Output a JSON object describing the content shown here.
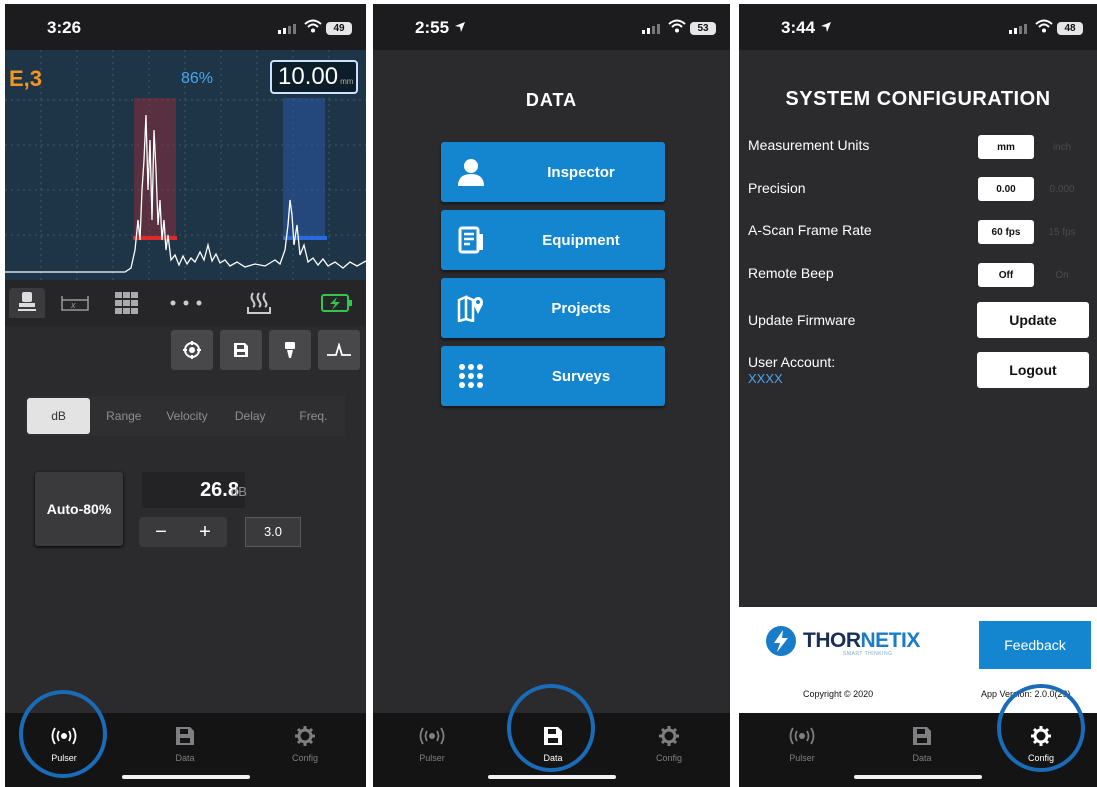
{
  "panel1": {
    "status": {
      "time": "3:26",
      "battery": "49"
    },
    "ascan": {
      "gate_mode": "E,3",
      "gain_percent": "86%",
      "thickness": "10.00",
      "thickness_unit": "mm"
    },
    "tools": [
      "transducer-icon",
      "caliper-icon",
      "grid-icon",
      "more-dots-icon",
      "couplant-icon",
      "battery-charging-icon"
    ],
    "actions": [
      "target-icon",
      "save-icon",
      "probe-icon",
      "waveform-icon"
    ],
    "params": {
      "tabs": [
        "dB",
        "Range",
        "Velocity",
        "Delay",
        "Freq."
      ],
      "selected": "dB"
    },
    "auto_button": "Auto-80%",
    "db_value": "26.8",
    "db_unit": "dB",
    "minus": "−",
    "plus": "+",
    "step": "3.0"
  },
  "panel2": {
    "status": {
      "time": "2:55",
      "battery": "53"
    },
    "title": "DATA",
    "buttons": [
      {
        "label": "Inspector",
        "icon": "person-icon"
      },
      {
        "label": "Equipment",
        "icon": "equipment-list-icon"
      },
      {
        "label": "Projects",
        "icon": "map-pin-icon"
      },
      {
        "label": "Surveys",
        "icon": "dots-grid-icon"
      }
    ]
  },
  "panel3": {
    "status": {
      "time": "3:44",
      "battery": "48"
    },
    "title": "SYSTEM CONFIGURATION",
    "rows": {
      "units": {
        "label": "Measurement Units",
        "options": [
          "mm",
          "inch"
        ],
        "selected": "mm"
      },
      "precision": {
        "label": "Precision",
        "options": [
          "0.00",
          "0.000"
        ],
        "selected": "0.00"
      },
      "framerate": {
        "label": "A-Scan Frame Rate",
        "options": [
          "60 fps",
          "15 fps"
        ],
        "selected": "60 fps"
      },
      "beep": {
        "label": "Remote Beep",
        "options": [
          "Off",
          "On"
        ],
        "selected": "Off"
      },
      "firmware": {
        "label": "Update Firmware",
        "button": "Update"
      },
      "account": {
        "label": "User Account:",
        "value": "XXXX",
        "button": "Logout"
      }
    },
    "footer": {
      "brand_part1": "THOR",
      "brand_part2": "NETIX",
      "tagline": "SMART THINKING",
      "copyright": "Copyright © 2020",
      "feedback": "Feedback",
      "version": "App Version: 2.0.0(29)"
    }
  },
  "tabbar": {
    "pulser": "Pulser",
    "data": "Data",
    "config": "Config"
  },
  "colors": {
    "accent": "#1386cf",
    "ring": "#1a6bb8",
    "gate_red": "#e02a2a",
    "gate_blue": "#2a6ae0",
    "mode_orange": "#f3951f"
  }
}
